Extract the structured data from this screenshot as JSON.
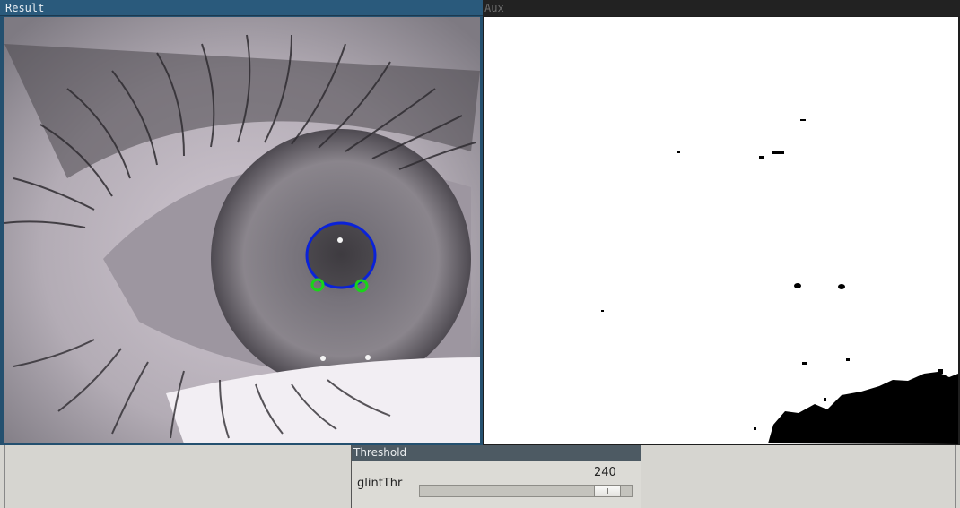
{
  "windows": {
    "result": {
      "title": "Result"
    },
    "aux": {
      "title": "Aux"
    },
    "threshold": {
      "title": "Threshold"
    }
  },
  "trackbar": {
    "label": "glintThr",
    "value": "240",
    "fraction": 0.94
  },
  "colors": {
    "pupil_ellipse": "#0a22d8",
    "glint_marker": "#19d419",
    "result_titlebar": "#2a5a7c",
    "threshold_titlebar": "#4d5a63"
  },
  "icons": {
    "pupil_marker": "ellipse",
    "glint_markers": "circle"
  }
}
